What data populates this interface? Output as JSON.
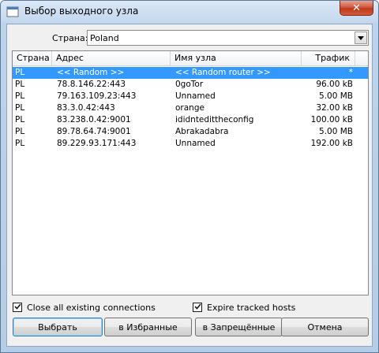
{
  "window": {
    "title": "Выбор выходного узла",
    "close_glyph": "✕"
  },
  "country": {
    "label": "Страна:",
    "value": "Poland"
  },
  "table": {
    "headers": [
      "Страна",
      "Адрес",
      "Имя узла",
      "Трафик"
    ],
    "rows": [
      [
        "PL",
        "<< Random >>",
        "<< Random router >>",
        "*"
      ],
      [
        "PL",
        "78.8.146.22:443",
        "0goTor",
        "96.00 kB"
      ],
      [
        "PL",
        "79.163.109.23:443",
        "Unnamed",
        "5.00 MB"
      ],
      [
        "PL",
        "83.3.0.42:443",
        "orange",
        "32.00 kB"
      ],
      [
        "PL",
        "83.238.0.42:9001",
        "ididntedittheconfig",
        "100.00 kB"
      ],
      [
        "PL",
        "89.78.64.74:9001",
        "Abrakadabra",
        "5.00 MB"
      ],
      [
        "PL",
        "89.229.93.171:443",
        "Unnamed",
        "192.00 kB"
      ]
    ],
    "selected_row": 0
  },
  "options": {
    "close_connections": {
      "label": "Close all existing connections",
      "checked": true
    },
    "expire_hosts": {
      "label": "Expire tracked hosts",
      "checked": true
    }
  },
  "buttons": {
    "select": "Выбрать",
    "favorites": "в Избранные",
    "forbidden": "в Запрещённые",
    "cancel": "Отмена"
  },
  "colors": {
    "selection": "#3399ff",
    "close_button": "#c7432b"
  },
  "icons": {
    "title": "window-app-icon",
    "dropdown": "chevron-down-icon",
    "check": "checkmark-icon"
  }
}
